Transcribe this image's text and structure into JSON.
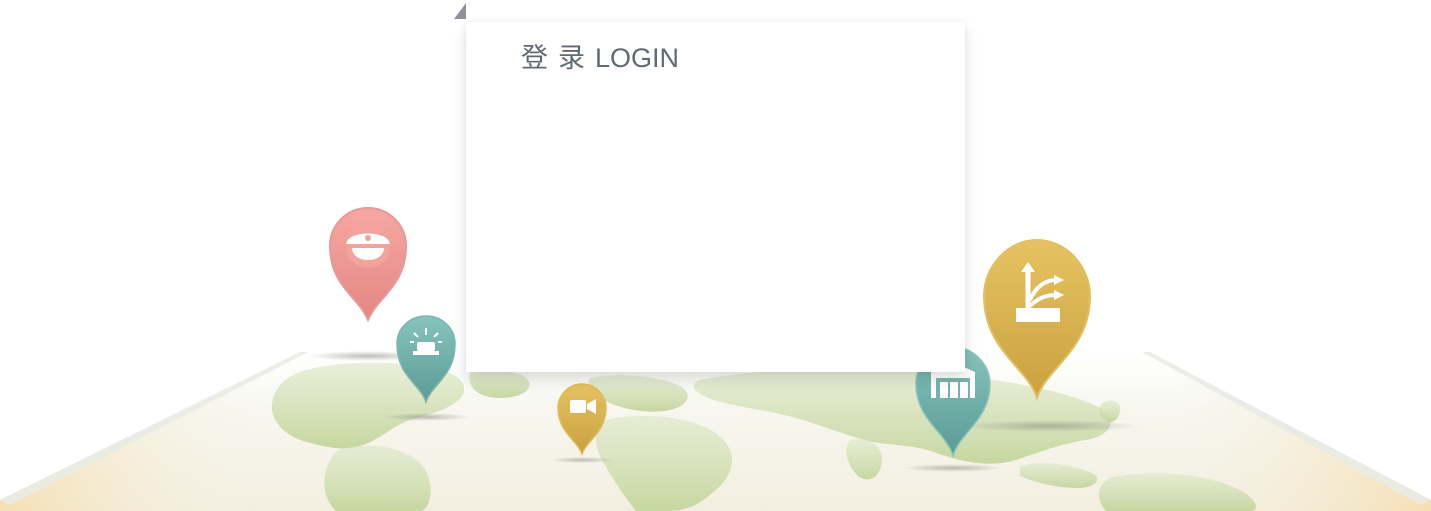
{
  "login": {
    "title_cn_1": "登",
    "title_cn_2": "录",
    "title_en": "LOGIN"
  },
  "map_pins": [
    {
      "name": "police-pin",
      "icon": "police-cap-icon",
      "color": "#ef8f8c"
    },
    {
      "name": "alarm-pin",
      "icon": "siren-icon",
      "color": "#6fada7"
    },
    {
      "name": "camera-pin",
      "icon": "video-camera-icon",
      "color": "#d4b24f"
    },
    {
      "name": "warehouse-pin",
      "icon": "warehouse-icon",
      "color": "#6fb0a8"
    },
    {
      "name": "route-pin",
      "icon": "road-sign-icon",
      "color": "#d6b24a"
    }
  ],
  "colors": {
    "land": "#cddcaa",
    "sea": "#f6f6ef",
    "title": "#626b75"
  }
}
